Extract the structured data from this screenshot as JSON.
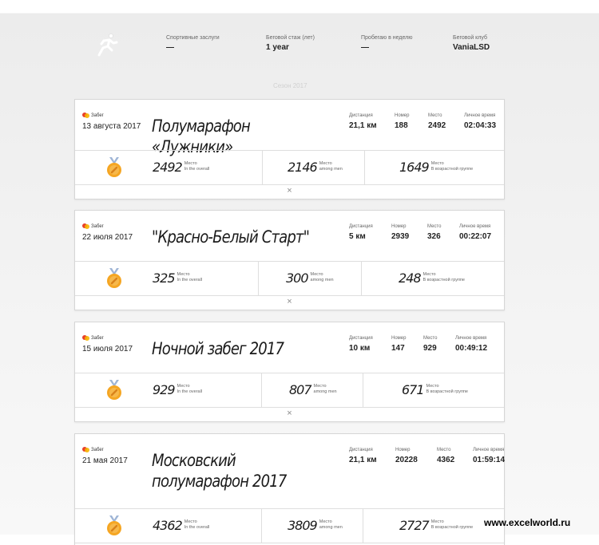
{
  "header": {
    "stats": [
      {
        "label": "Спортивные заслуги",
        "value": "—"
      },
      {
        "label": "Беговой стаж (лет)",
        "value": "1 year"
      },
      {
        "label": "Пробегаю в неделю",
        "value": "—"
      },
      {
        "label": "Беговой клуб",
        "value": "VaniaLSD"
      }
    ]
  },
  "season": "Сезон 2017",
  "labels": {
    "badge": "Забег",
    "distance": "Дистанция",
    "number": "Номер",
    "place": "Место",
    "personal_time": "Личное время",
    "place_word": "Место",
    "overall": "In the overall",
    "among_men": "among men",
    "age_group": "В возрастной группе",
    "close": "×"
  },
  "races": [
    {
      "date": "13 августа 2017",
      "title": "Полумарафон «Лужники»",
      "distance": "21,1 км",
      "number": "188",
      "place": "2492",
      "time": "02:04:33",
      "overall": "2492",
      "men": "2146",
      "age": "1649"
    },
    {
      "date": "22 июля 2017",
      "title": "\"Красно-Белый Старт\"",
      "distance": "5 км",
      "number": "2939",
      "place": "326",
      "time": "00:22:07",
      "overall": "325",
      "men": "300",
      "age": "248"
    },
    {
      "date": "15 июля 2017",
      "title": "Ночной забег 2017",
      "distance": "10 км",
      "number": "147",
      "place": "929",
      "time": "00:49:12",
      "overall": "929",
      "men": "807",
      "age": "671"
    },
    {
      "date": "21 мая 2017",
      "title": "Московский полумарафон 2017",
      "distance": "21,1 км",
      "number": "20228",
      "place": "4362",
      "time": "01:59:14",
      "overall": "4362",
      "men": "3809",
      "age": "2727"
    }
  ],
  "watermark": "www.excelworld.ru",
  "colors": {
    "medal_orange": "#f5a623",
    "medal_ribbon": "#9fb5d6",
    "badge_red": "#e8402a",
    "badge_yellow": "#f6b400"
  }
}
